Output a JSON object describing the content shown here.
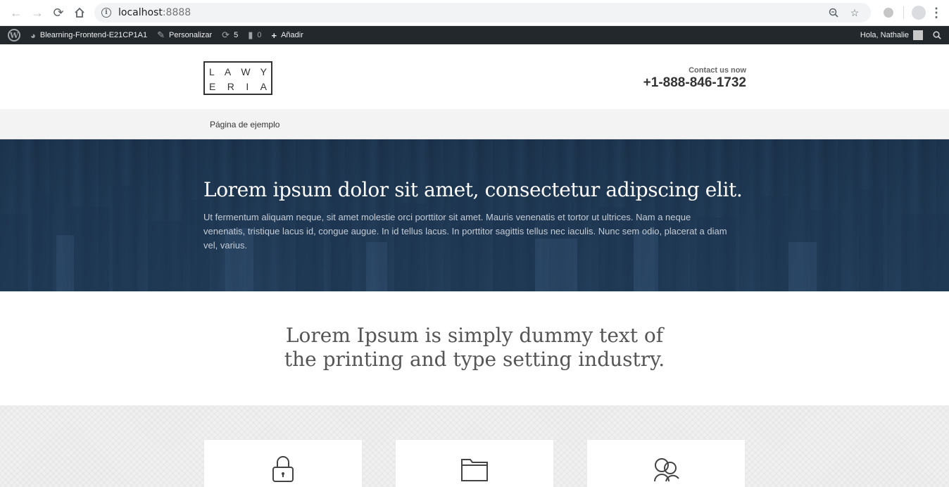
{
  "browser": {
    "url_host": "localhost",
    "url_port": ":8888",
    "icons": [
      "back-icon",
      "forward-icon",
      "reload-icon",
      "home-icon",
      "info-icon",
      "zoom-icon",
      "star-icon",
      "extension-icon",
      "profile-icon",
      "menu-icon"
    ]
  },
  "admin_bar": {
    "site_name": "Blearning-Frontend-E21CP1A1",
    "customize": "Personalizar",
    "updates_count": "5",
    "comments_count": "0",
    "add_new": "Añadir",
    "greeting": "Hola, Nathalie"
  },
  "header": {
    "logo_line1": [
      "L",
      "A",
      "W",
      "Y"
    ],
    "logo_line2": [
      "E",
      "R",
      "I",
      "A"
    ],
    "contact_label": "Contact us now",
    "phone": "+1-888-846-1732"
  },
  "menu": {
    "items": [
      "Página de ejemplo"
    ]
  },
  "hero": {
    "title": "Lorem ipsum dolor sit amet, consectetur adipscing elit.",
    "text": "Ut fermentum aliquam neque, sit amet molestie orci porttitor sit amet. Mauris venenatis et tortor ut ultrices. Nam a neque venenatis, tristique lacus id, congue augue. In id tellus lacus. In porttitor sagittis tellus nec iaculis. Nunc sem odio, placerat a diam vel, varius."
  },
  "intro": {
    "line1": "Lorem Ipsum is simply dummy text of",
    "line2": "the printing and type setting industry."
  },
  "features": {
    "icons": [
      "lock-icon",
      "folder-icon",
      "users-icon"
    ]
  },
  "colors": {
    "admin_bar_bg": "#23282d",
    "hero_overlay": "#1f3a55",
    "menu_bg": "#f3f3f3"
  }
}
